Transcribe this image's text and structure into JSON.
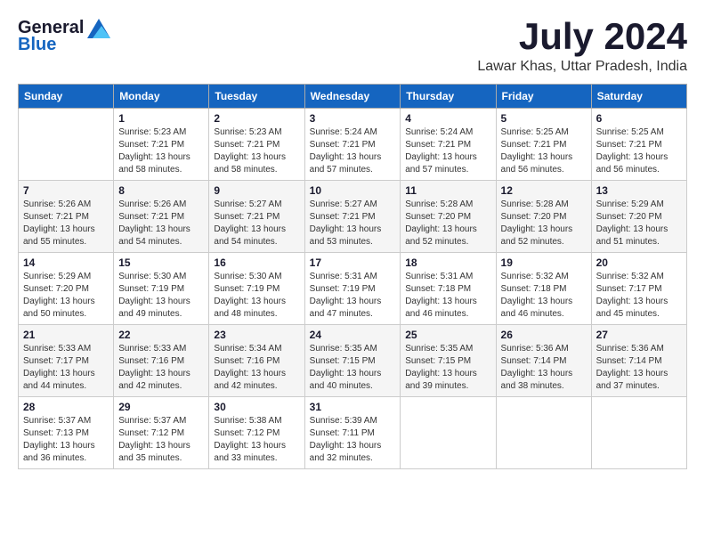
{
  "logo": {
    "general": "General",
    "blue": "Blue"
  },
  "title": "July 2024",
  "location": "Lawar Khas, Uttar Pradesh, India",
  "weekdays": [
    "Sunday",
    "Monday",
    "Tuesday",
    "Wednesday",
    "Thursday",
    "Friday",
    "Saturday"
  ],
  "weeks": [
    [
      {
        "day": "",
        "sunrise": "",
        "sunset": "",
        "daylight": ""
      },
      {
        "day": "1",
        "sunrise": "Sunrise: 5:23 AM",
        "sunset": "Sunset: 7:21 PM",
        "daylight": "Daylight: 13 hours and 58 minutes."
      },
      {
        "day": "2",
        "sunrise": "Sunrise: 5:23 AM",
        "sunset": "Sunset: 7:21 PM",
        "daylight": "Daylight: 13 hours and 58 minutes."
      },
      {
        "day": "3",
        "sunrise": "Sunrise: 5:24 AM",
        "sunset": "Sunset: 7:21 PM",
        "daylight": "Daylight: 13 hours and 57 minutes."
      },
      {
        "day": "4",
        "sunrise": "Sunrise: 5:24 AM",
        "sunset": "Sunset: 7:21 PM",
        "daylight": "Daylight: 13 hours and 57 minutes."
      },
      {
        "day": "5",
        "sunrise": "Sunrise: 5:25 AM",
        "sunset": "Sunset: 7:21 PM",
        "daylight": "Daylight: 13 hours and 56 minutes."
      },
      {
        "day": "6",
        "sunrise": "Sunrise: 5:25 AM",
        "sunset": "Sunset: 7:21 PM",
        "daylight": "Daylight: 13 hours and 56 minutes."
      }
    ],
    [
      {
        "day": "7",
        "sunrise": "Sunrise: 5:26 AM",
        "sunset": "Sunset: 7:21 PM",
        "daylight": "Daylight: 13 hours and 55 minutes."
      },
      {
        "day": "8",
        "sunrise": "Sunrise: 5:26 AM",
        "sunset": "Sunset: 7:21 PM",
        "daylight": "Daylight: 13 hours and 54 minutes."
      },
      {
        "day": "9",
        "sunrise": "Sunrise: 5:27 AM",
        "sunset": "Sunset: 7:21 PM",
        "daylight": "Daylight: 13 hours and 54 minutes."
      },
      {
        "day": "10",
        "sunrise": "Sunrise: 5:27 AM",
        "sunset": "Sunset: 7:21 PM",
        "daylight": "Daylight: 13 hours and 53 minutes."
      },
      {
        "day": "11",
        "sunrise": "Sunrise: 5:28 AM",
        "sunset": "Sunset: 7:20 PM",
        "daylight": "Daylight: 13 hours and 52 minutes."
      },
      {
        "day": "12",
        "sunrise": "Sunrise: 5:28 AM",
        "sunset": "Sunset: 7:20 PM",
        "daylight": "Daylight: 13 hours and 52 minutes."
      },
      {
        "day": "13",
        "sunrise": "Sunrise: 5:29 AM",
        "sunset": "Sunset: 7:20 PM",
        "daylight": "Daylight: 13 hours and 51 minutes."
      }
    ],
    [
      {
        "day": "14",
        "sunrise": "Sunrise: 5:29 AM",
        "sunset": "Sunset: 7:20 PM",
        "daylight": "Daylight: 13 hours and 50 minutes."
      },
      {
        "day": "15",
        "sunrise": "Sunrise: 5:30 AM",
        "sunset": "Sunset: 7:19 PM",
        "daylight": "Daylight: 13 hours and 49 minutes."
      },
      {
        "day": "16",
        "sunrise": "Sunrise: 5:30 AM",
        "sunset": "Sunset: 7:19 PM",
        "daylight": "Daylight: 13 hours and 48 minutes."
      },
      {
        "day": "17",
        "sunrise": "Sunrise: 5:31 AM",
        "sunset": "Sunset: 7:19 PM",
        "daylight": "Daylight: 13 hours and 47 minutes."
      },
      {
        "day": "18",
        "sunrise": "Sunrise: 5:31 AM",
        "sunset": "Sunset: 7:18 PM",
        "daylight": "Daylight: 13 hours and 46 minutes."
      },
      {
        "day": "19",
        "sunrise": "Sunrise: 5:32 AM",
        "sunset": "Sunset: 7:18 PM",
        "daylight": "Daylight: 13 hours and 46 minutes."
      },
      {
        "day": "20",
        "sunrise": "Sunrise: 5:32 AM",
        "sunset": "Sunset: 7:17 PM",
        "daylight": "Daylight: 13 hours and 45 minutes."
      }
    ],
    [
      {
        "day": "21",
        "sunrise": "Sunrise: 5:33 AM",
        "sunset": "Sunset: 7:17 PM",
        "daylight": "Daylight: 13 hours and 44 minutes."
      },
      {
        "day": "22",
        "sunrise": "Sunrise: 5:33 AM",
        "sunset": "Sunset: 7:16 PM",
        "daylight": "Daylight: 13 hours and 42 minutes."
      },
      {
        "day": "23",
        "sunrise": "Sunrise: 5:34 AM",
        "sunset": "Sunset: 7:16 PM",
        "daylight": "Daylight: 13 hours and 42 minutes."
      },
      {
        "day": "24",
        "sunrise": "Sunrise: 5:35 AM",
        "sunset": "Sunset: 7:15 PM",
        "daylight": "Daylight: 13 hours and 40 minutes."
      },
      {
        "day": "25",
        "sunrise": "Sunrise: 5:35 AM",
        "sunset": "Sunset: 7:15 PM",
        "daylight": "Daylight: 13 hours and 39 minutes."
      },
      {
        "day": "26",
        "sunrise": "Sunrise: 5:36 AM",
        "sunset": "Sunset: 7:14 PM",
        "daylight": "Daylight: 13 hours and 38 minutes."
      },
      {
        "day": "27",
        "sunrise": "Sunrise: 5:36 AM",
        "sunset": "Sunset: 7:14 PM",
        "daylight": "Daylight: 13 hours and 37 minutes."
      }
    ],
    [
      {
        "day": "28",
        "sunrise": "Sunrise: 5:37 AM",
        "sunset": "Sunset: 7:13 PM",
        "daylight": "Daylight: 13 hours and 36 minutes."
      },
      {
        "day": "29",
        "sunrise": "Sunrise: 5:37 AM",
        "sunset": "Sunset: 7:12 PM",
        "daylight": "Daylight: 13 hours and 35 minutes."
      },
      {
        "day": "30",
        "sunrise": "Sunrise: 5:38 AM",
        "sunset": "Sunset: 7:12 PM",
        "daylight": "Daylight: 13 hours and 33 minutes."
      },
      {
        "day": "31",
        "sunrise": "Sunrise: 5:39 AM",
        "sunset": "Sunset: 7:11 PM",
        "daylight": "Daylight: 13 hours and 32 minutes."
      },
      {
        "day": "",
        "sunrise": "",
        "sunset": "",
        "daylight": ""
      },
      {
        "day": "",
        "sunrise": "",
        "sunset": "",
        "daylight": ""
      },
      {
        "day": "",
        "sunrise": "",
        "sunset": "",
        "daylight": ""
      }
    ]
  ]
}
